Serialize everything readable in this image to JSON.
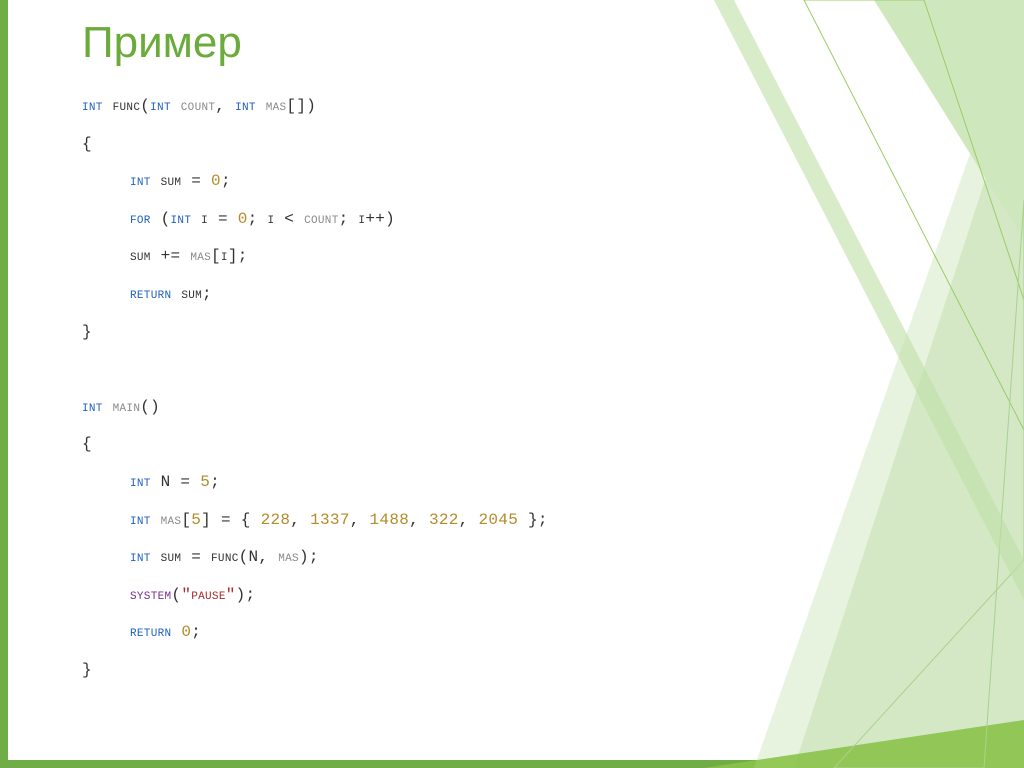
{
  "title": "Пример",
  "code": {
    "l1_int": "int",
    "l1_func": " func(",
    "l1_int2": "int",
    "l1_count": " count",
    "l1_comma": ", ",
    "l1_int3": "int",
    "l1_mas": " mas",
    "l1_brk": "[])",
    "brace_open": "{",
    "brace_close": "}",
    "l3_int": "int",
    "l3_rest": " sum = ",
    "l3_zero": "0",
    "l3_semi": ";",
    "l4_for": "for",
    "l4_open": " (",
    "l4_int": "int",
    "l4_mid_a": " i = ",
    "l4_zero": "0",
    "l4_mid_b": "; i < ",
    "l4_count": "count",
    "l4_mid_c": "; i++)",
    "l5_a": "sum += ",
    "l5_mas": "mas",
    "l5_c": "[i];",
    "l6_ret": "return",
    "l6_rest": " sum;",
    "l9_int": "int",
    "l9_sp": " ",
    "l9_main": "main",
    "l9_par": "()",
    "l11_int": "int",
    "l11_rest": " N = ",
    "l11_five": "5",
    "l11_semi": ";",
    "l12_int": "int",
    "l12_sp": " ",
    "l12_mas": "mas",
    "l12_a": "[",
    "l12_five": "5",
    "l12_b": "] = { ",
    "l12_n1": "228",
    "l12_c1": ", ",
    "l12_n2": "1337",
    "l12_c2": ", ",
    "l12_n3": "1488",
    "l12_c3": ", ",
    "l12_n4": "322",
    "l12_c4": ", ",
    "l12_n5": "2045",
    "l12_end": " };",
    "l13_int": "int",
    "l13_rest": " sum = func(N, ",
    "l13_mas": "mas",
    "l13_end": ");",
    "l14_sys": "system",
    "l14_open": "(",
    "l14_str": "\"pause\"",
    "l14_close": ");",
    "l15_ret": "return",
    "l15_sp": " ",
    "l15_zero": "0",
    "l15_semi": ";"
  }
}
